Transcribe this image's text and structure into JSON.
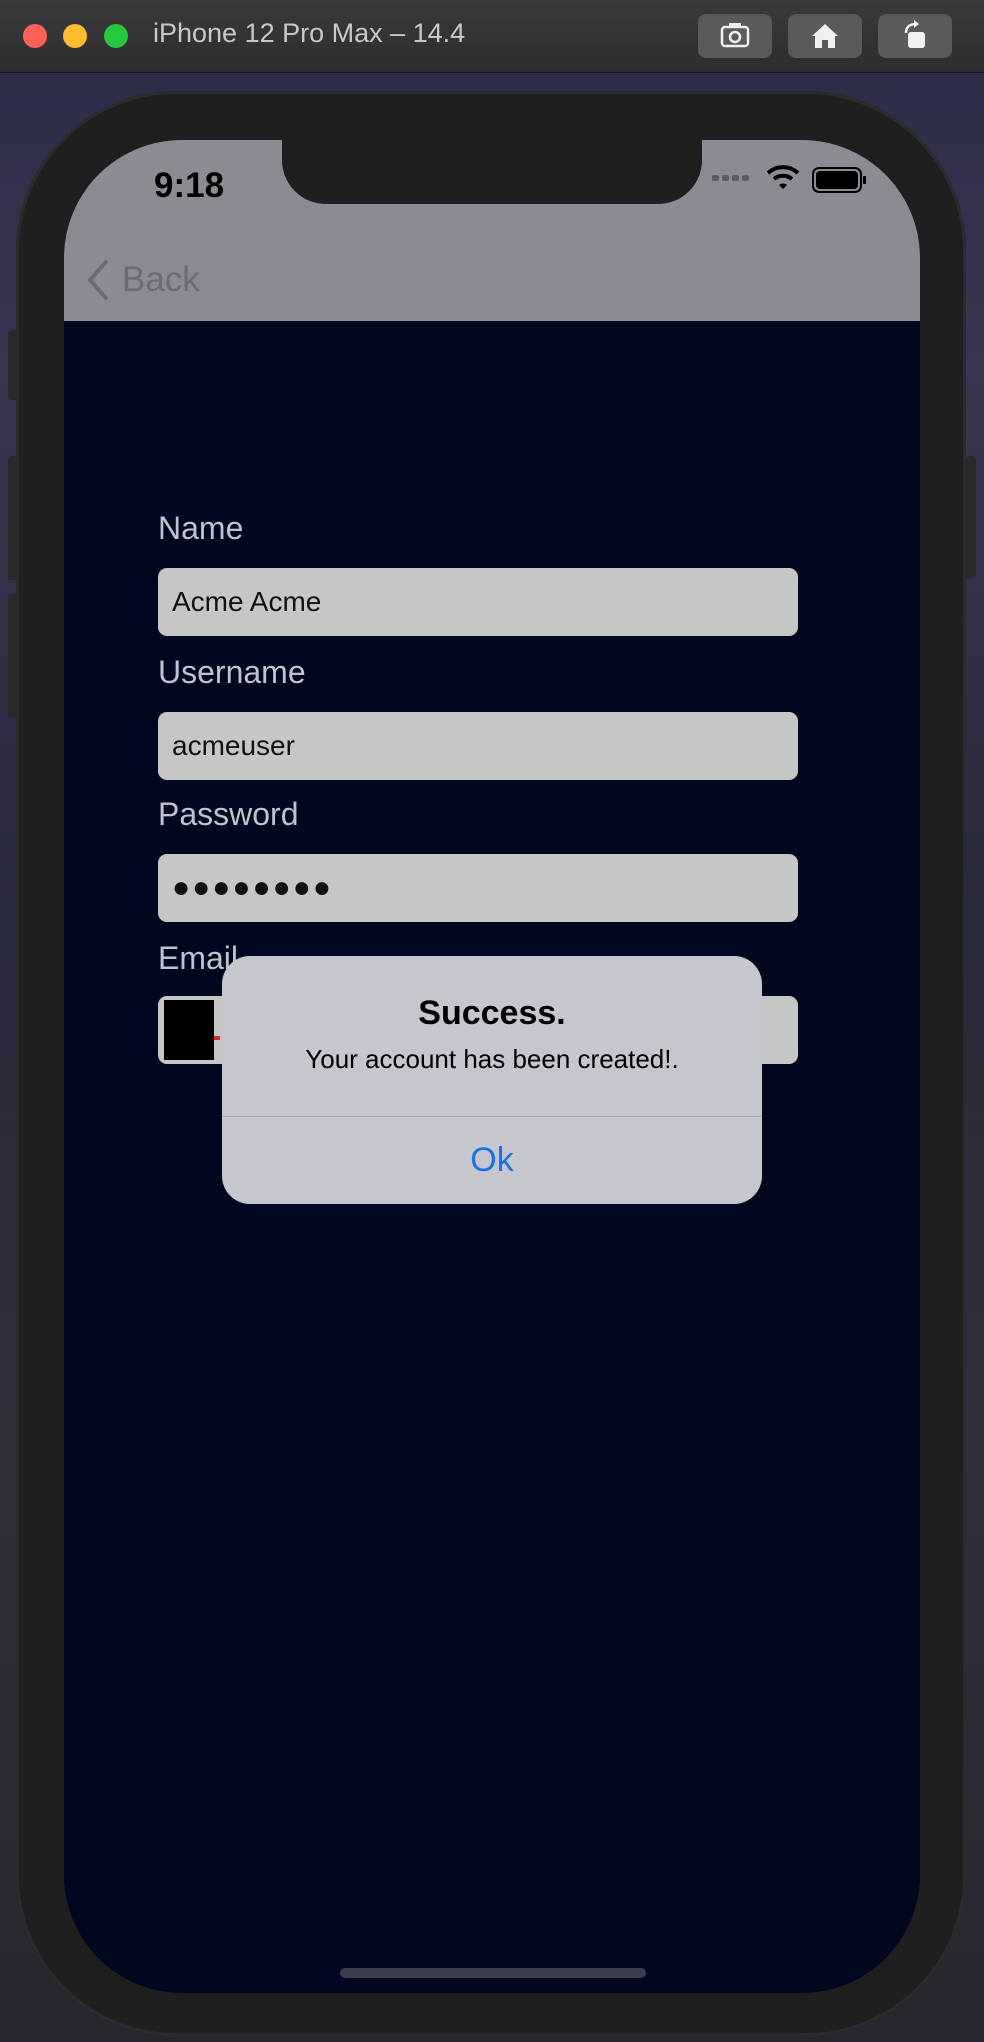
{
  "window": {
    "title": "iPhone 12 Pro Max – 14.4",
    "toolbar": [
      {
        "icon": "screenshot-icon"
      },
      {
        "icon": "home-icon"
      },
      {
        "icon": "rotate-icon"
      }
    ]
  },
  "status_bar": {
    "time": "9:18"
  },
  "nav": {
    "back_label": "Back"
  },
  "form": {
    "name_label": "Name",
    "name_value": "Acme Acme",
    "username_label": "Username",
    "username_value": "acmeuser",
    "password_label": "Password",
    "password_value": "●●●●●●●●",
    "email_label": "Email",
    "email_value": ""
  },
  "alert": {
    "title": "Success.",
    "message": "Your account has been created!.",
    "ok_label": "Ok"
  },
  "colors": {
    "accent": "#1a72e6",
    "screen_bg": "#020720",
    "field_bg": "#c6c6c6"
  }
}
